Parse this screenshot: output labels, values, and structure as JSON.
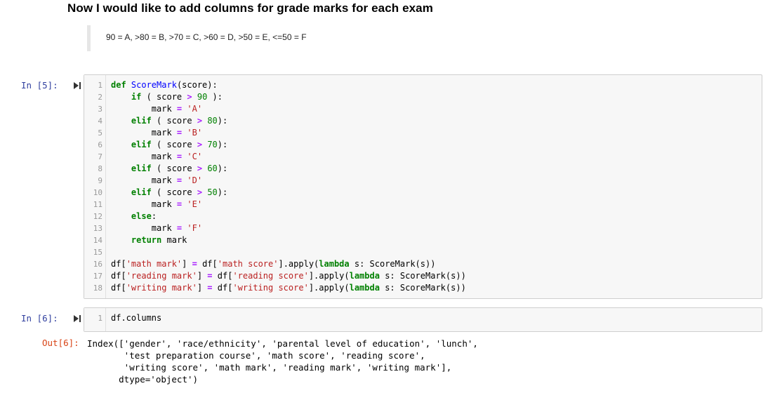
{
  "markdown": {
    "heading": "Now I would like to add columns for grade marks for each exam",
    "quote": "90 = A, >80 = B, >70 = C, >60 = D, >50 = E, <=50 = F"
  },
  "cell5": {
    "prompt": "In [5]:",
    "lines": [
      {
        "n": "1",
        "tokens": [
          {
            "t": "def ",
            "c": "kw"
          },
          {
            "t": "ScoreMark",
            "c": "fn"
          },
          {
            "t": "(score):",
            "c": ""
          }
        ]
      },
      {
        "n": "2",
        "tokens": [
          {
            "t": "    ",
            "c": ""
          },
          {
            "t": "if",
            "c": "kw"
          },
          {
            "t": " ( score ",
            "c": ""
          },
          {
            "t": ">",
            "c": "op"
          },
          {
            "t": " ",
            "c": ""
          },
          {
            "t": "90",
            "c": "nm"
          },
          {
            "t": " ):",
            "c": ""
          }
        ]
      },
      {
        "n": "3",
        "tokens": [
          {
            "t": "        mark ",
            "c": ""
          },
          {
            "t": "=",
            "c": "op"
          },
          {
            "t": " ",
            "c": ""
          },
          {
            "t": "'A'",
            "c": "st"
          }
        ]
      },
      {
        "n": "4",
        "tokens": [
          {
            "t": "    ",
            "c": ""
          },
          {
            "t": "elif",
            "c": "kw"
          },
          {
            "t": " ( score ",
            "c": ""
          },
          {
            "t": ">",
            "c": "op"
          },
          {
            "t": " ",
            "c": ""
          },
          {
            "t": "80",
            "c": "nm"
          },
          {
            "t": "):",
            "c": ""
          }
        ]
      },
      {
        "n": "5",
        "tokens": [
          {
            "t": "        mark ",
            "c": ""
          },
          {
            "t": "=",
            "c": "op"
          },
          {
            "t": " ",
            "c": ""
          },
          {
            "t": "'B'",
            "c": "st"
          }
        ]
      },
      {
        "n": "6",
        "tokens": [
          {
            "t": "    ",
            "c": ""
          },
          {
            "t": "elif",
            "c": "kw"
          },
          {
            "t": " ( score ",
            "c": ""
          },
          {
            "t": ">",
            "c": "op"
          },
          {
            "t": " ",
            "c": ""
          },
          {
            "t": "70",
            "c": "nm"
          },
          {
            "t": "):",
            "c": ""
          }
        ]
      },
      {
        "n": "7",
        "tokens": [
          {
            "t": "        mark ",
            "c": ""
          },
          {
            "t": "=",
            "c": "op"
          },
          {
            "t": " ",
            "c": ""
          },
          {
            "t": "'C'",
            "c": "st"
          }
        ]
      },
      {
        "n": "8",
        "tokens": [
          {
            "t": "    ",
            "c": ""
          },
          {
            "t": "elif",
            "c": "kw"
          },
          {
            "t": " ( score ",
            "c": ""
          },
          {
            "t": ">",
            "c": "op"
          },
          {
            "t": " ",
            "c": ""
          },
          {
            "t": "60",
            "c": "nm"
          },
          {
            "t": "):",
            "c": ""
          }
        ]
      },
      {
        "n": "9",
        "tokens": [
          {
            "t": "        mark ",
            "c": ""
          },
          {
            "t": "=",
            "c": "op"
          },
          {
            "t": " ",
            "c": ""
          },
          {
            "t": "'D'",
            "c": "st"
          }
        ]
      },
      {
        "n": "10",
        "tokens": [
          {
            "t": "    ",
            "c": ""
          },
          {
            "t": "elif",
            "c": "kw"
          },
          {
            "t": " ( score ",
            "c": ""
          },
          {
            "t": ">",
            "c": "op"
          },
          {
            "t": " ",
            "c": ""
          },
          {
            "t": "50",
            "c": "nm"
          },
          {
            "t": "):",
            "c": ""
          }
        ]
      },
      {
        "n": "11",
        "tokens": [
          {
            "t": "        mark ",
            "c": ""
          },
          {
            "t": "=",
            "c": "op"
          },
          {
            "t": " ",
            "c": ""
          },
          {
            "t": "'E'",
            "c": "st"
          }
        ]
      },
      {
        "n": "12",
        "tokens": [
          {
            "t": "    ",
            "c": ""
          },
          {
            "t": "else",
            "c": "kw"
          },
          {
            "t": ":",
            "c": ""
          }
        ]
      },
      {
        "n": "13",
        "tokens": [
          {
            "t": "        mark ",
            "c": ""
          },
          {
            "t": "=",
            "c": "op"
          },
          {
            "t": " ",
            "c": ""
          },
          {
            "t": "'F'",
            "c": "st"
          }
        ]
      },
      {
        "n": "14",
        "tokens": [
          {
            "t": "    ",
            "c": ""
          },
          {
            "t": "return",
            "c": "kw"
          },
          {
            "t": " mark",
            "c": ""
          }
        ]
      },
      {
        "n": "15",
        "tokens": []
      },
      {
        "n": "16",
        "tokens": [
          {
            "t": "df[",
            "c": ""
          },
          {
            "t": "'math mark'",
            "c": "st"
          },
          {
            "t": "] ",
            "c": ""
          },
          {
            "t": "=",
            "c": "op"
          },
          {
            "t": " df[",
            "c": ""
          },
          {
            "t": "'math score'",
            "c": "st"
          },
          {
            "t": "].apply(",
            "c": ""
          },
          {
            "t": "lambda",
            "c": "kw"
          },
          {
            "t": " s: ScoreMark(s))",
            "c": ""
          }
        ]
      },
      {
        "n": "17",
        "tokens": [
          {
            "t": "df[",
            "c": ""
          },
          {
            "t": "'reading mark'",
            "c": "st"
          },
          {
            "t": "] ",
            "c": ""
          },
          {
            "t": "=",
            "c": "op"
          },
          {
            "t": " df[",
            "c": ""
          },
          {
            "t": "'reading score'",
            "c": "st"
          },
          {
            "t": "].apply(",
            "c": ""
          },
          {
            "t": "lambda",
            "c": "kw"
          },
          {
            "t": " s: ScoreMark(s))",
            "c": ""
          }
        ]
      },
      {
        "n": "18",
        "tokens": [
          {
            "t": "df[",
            "c": ""
          },
          {
            "t": "'writing mark'",
            "c": "st"
          },
          {
            "t": "] ",
            "c": ""
          },
          {
            "t": "=",
            "c": "op"
          },
          {
            "t": " df[",
            "c": ""
          },
          {
            "t": "'writing score'",
            "c": "st"
          },
          {
            "t": "].apply(",
            "c": ""
          },
          {
            "t": "lambda",
            "c": "kw"
          },
          {
            "t": " s: ScoreMark(s))",
            "c": ""
          }
        ]
      }
    ]
  },
  "cell6": {
    "prompt": "In [6]:",
    "lines": [
      {
        "n": "1",
        "tokens": [
          {
            "t": "df.columns",
            "c": ""
          }
        ]
      }
    ],
    "out_prompt": "Out[6]:",
    "output": "Index(['gender', 'race/ethnicity', 'parental level of education', 'lunch',\n       'test preparation course', 'math score', 'reading score',\n       'writing score', 'math mark', 'reading mark', 'writing mark'],\n      dtype='object')"
  },
  "colors": {
    "in_prompt": "#303f9f",
    "out_prompt": "#d84315",
    "keyword": "#008000",
    "string": "#ba2121",
    "operator": "#aa22ff",
    "function": "#0000ff"
  },
  "icons": {
    "run": "run-cell-icon"
  }
}
